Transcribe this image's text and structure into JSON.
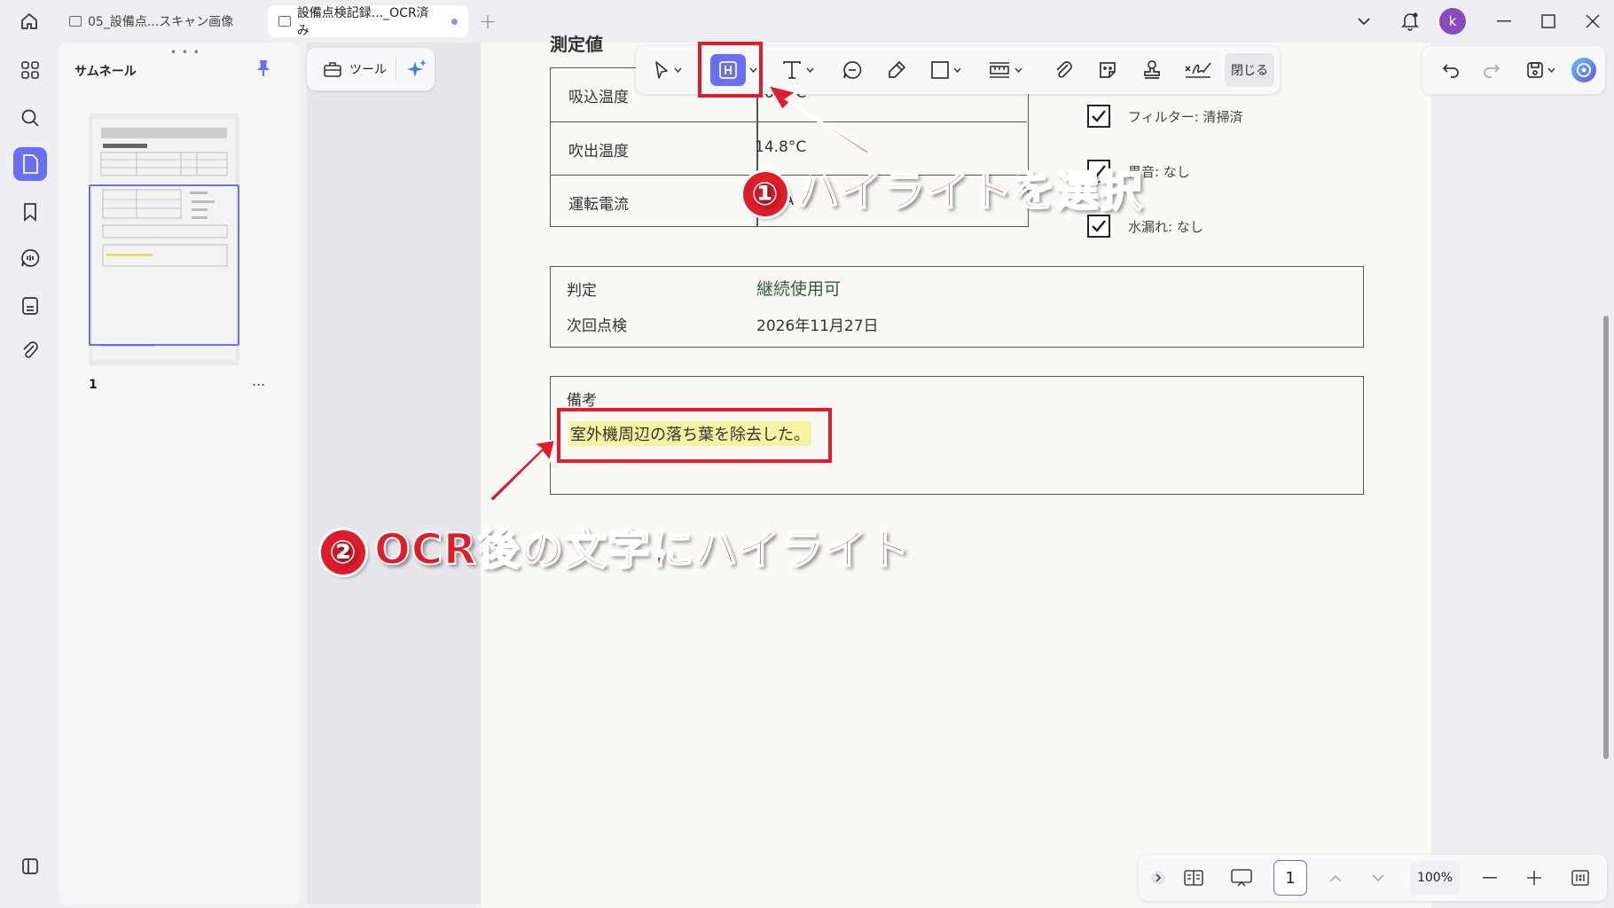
{
  "tabs": [
    {
      "label": "05_設備点...スキャン画像"
    },
    {
      "label": "設備点検記録..._OCR済み"
    }
  ],
  "user": {
    "initial": "k"
  },
  "thumbnail_panel": {
    "title": "サムネール",
    "page_number": "1",
    "more": "..."
  },
  "tools": {
    "label": "ツール"
  },
  "annotation_toolbar": {
    "close_label": "閉じる"
  },
  "document": {
    "heading": "測定値",
    "measurements": [
      {
        "label": "吸込温度",
        "value": "26.4°C"
      },
      {
        "label": "吹出温度",
        "value": "14.8°C"
      },
      {
        "label": "運転電流",
        "value": "7.2 A"
      }
    ],
    "checklist": [
      {
        "label": "フィルター: 清掃済"
      },
      {
        "label": "異音: なし"
      },
      {
        "label": "水漏れ: なし"
      }
    ],
    "judgement": {
      "label": "判定",
      "value": "継続使用可"
    },
    "next_inspection": {
      "label": "次回点検",
      "value": "2026年11月27日"
    },
    "remarks": {
      "label": "備考",
      "text": "室外機周辺の落ち葉を除去した。"
    }
  },
  "zoom": {
    "page": "1",
    "level": "100%"
  },
  "callouts": [
    {
      "number": "①",
      "text": "ハイライトを選択"
    },
    {
      "number": "②",
      "text": "OCR後の文字にハイライト"
    }
  ],
  "colors": {
    "accent": "#6a6ef6",
    "callout_red": "#e11c2a",
    "highlight": "#f6f2a2"
  }
}
